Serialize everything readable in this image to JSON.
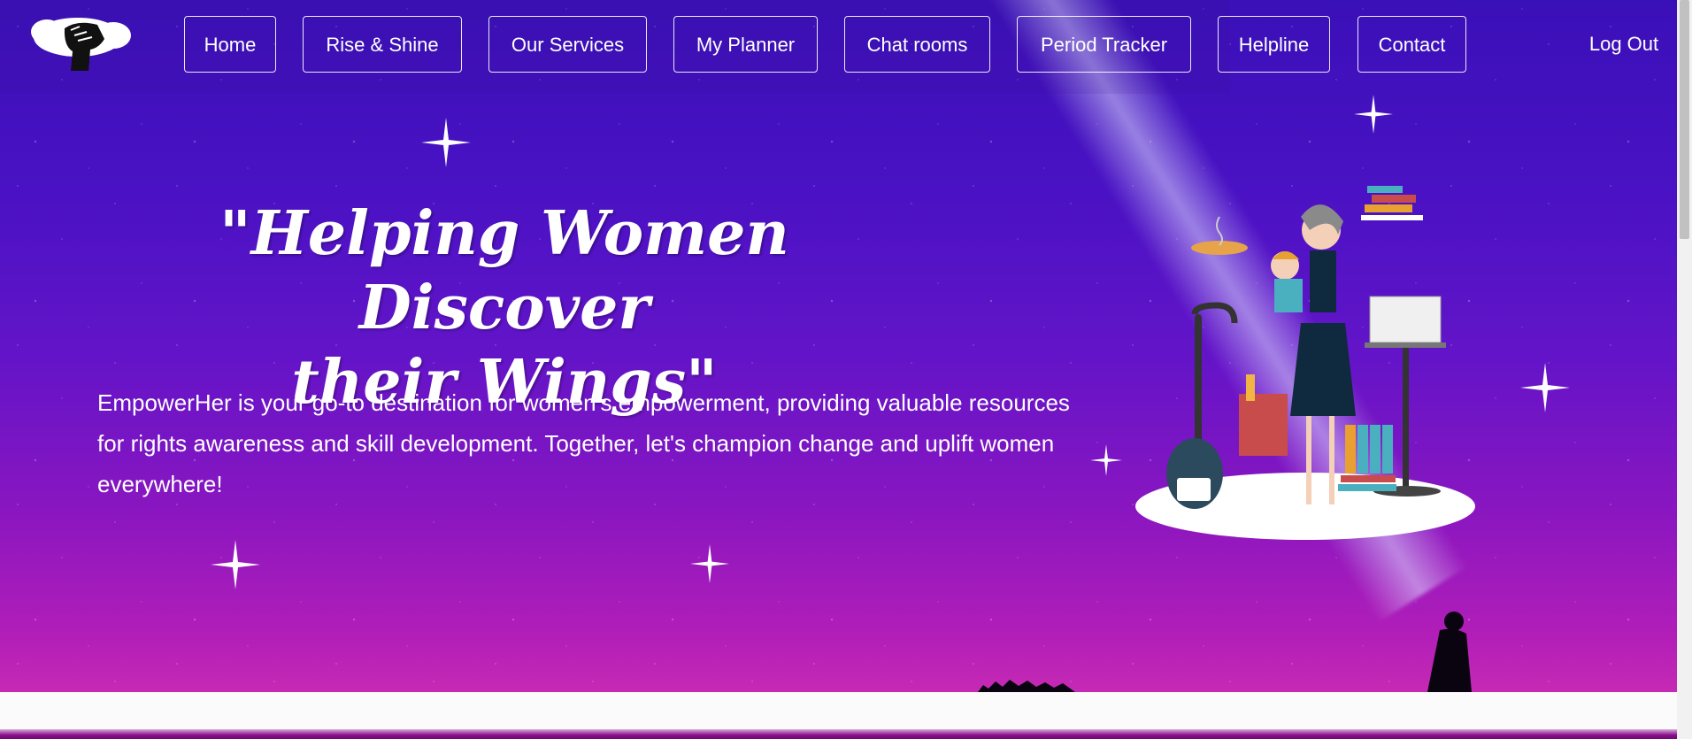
{
  "brand": {
    "logo_icon": "raised-fist-logo-icon"
  },
  "nav": {
    "items": [
      {
        "label": "Home"
      },
      {
        "label": "Rise & Shine"
      },
      {
        "label": "Our Services"
      },
      {
        "label": "My Planner"
      },
      {
        "label": "Chat rooms"
      },
      {
        "label": "Period Tracker"
      },
      {
        "label": "Helpline"
      },
      {
        "label": "Contact"
      }
    ],
    "logout_label": "Log Out"
  },
  "hero": {
    "headline_line1": "\"Helping Women Discover",
    "headline_line2": "their Wings\"",
    "description": "EmpowerHer is your go-to destination for women's empowerment, providing valuable resources for rights awareness and skill development. Together, let's champion change and uplift women everywhere!",
    "illustration_icon": "multitasking-woman-illustration",
    "colors": {
      "sky_top": "#3a10b8",
      "sky_bottom": "#c62ab4",
      "text": "#ffffff"
    }
  }
}
